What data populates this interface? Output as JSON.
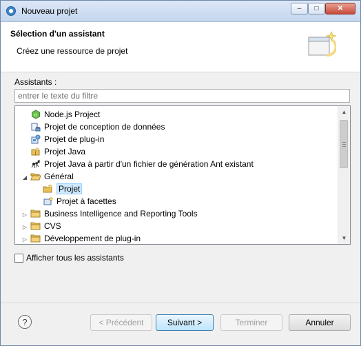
{
  "window": {
    "title": "Nouveau projet",
    "controls": {
      "minimize": "–",
      "maximize": "□",
      "close": "✕"
    }
  },
  "header": {
    "title": "Sélection d'un assistant",
    "description": "Créez une ressource de projet"
  },
  "wizards": {
    "label": "Assistants :",
    "filter_placeholder": "entrer le texte du filtre",
    "items": [
      {
        "label": "Node.js Project",
        "icon": "nodejs-icon"
      },
      {
        "label": "Projet de conception de données",
        "icon": "data-design-icon"
      },
      {
        "label": "Projet de plug-in",
        "icon": "plugin-project-icon"
      },
      {
        "label": "Projet Java",
        "icon": "java-project-icon"
      },
      {
        "label": "Projet Java à partir d'un fichier de génération Ant existant",
        "icon": "ant-icon"
      },
      {
        "label": "Général",
        "icon": "folder-open-icon",
        "expanded": true
      },
      {
        "label": "Projet",
        "icon": "project-icon",
        "selected": true
      },
      {
        "label": "Projet à facettes",
        "icon": "faceted-project-icon"
      },
      {
        "label": "Business Intelligence and Reporting Tools",
        "icon": "folder-icon",
        "expanded": false
      },
      {
        "label": "CVS",
        "icon": "folder-icon",
        "expanded": false
      },
      {
        "label": "Développement de plug-in",
        "icon": "folder-icon",
        "expanded": false
      }
    ]
  },
  "show_all": {
    "label": "Afficher tous les assistants",
    "checked": false
  },
  "buttons": {
    "help": "?",
    "back": "< Précédent",
    "next": "Suivant >",
    "finish": "Terminer",
    "cancel": "Annuler"
  },
  "colors": {
    "selection": "#cde8ff",
    "accent": "#3c7fb1",
    "folder": "#e8c15a"
  }
}
